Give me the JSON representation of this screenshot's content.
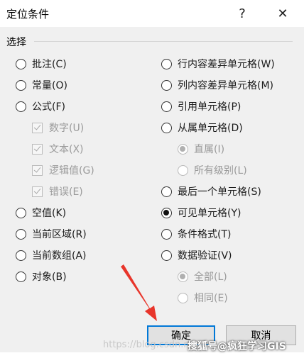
{
  "dialog": {
    "title": "定位条件",
    "help_glyph": "?",
    "close_glyph": "✕"
  },
  "group": {
    "label": "选择"
  },
  "left_options": [
    {
      "label": "批注(C)",
      "type": "radio",
      "checked": false,
      "disabled": false
    },
    {
      "label": "常量(O)",
      "type": "radio",
      "checked": false,
      "disabled": false
    },
    {
      "label": "公式(F)",
      "type": "radio",
      "checked": false,
      "disabled": false
    },
    {
      "label": "数字(U)",
      "type": "checkbox",
      "checked": true,
      "disabled": true
    },
    {
      "label": "文本(X)",
      "type": "checkbox",
      "checked": true,
      "disabled": true
    },
    {
      "label": "逻辑值(G)",
      "type": "checkbox",
      "checked": true,
      "disabled": true
    },
    {
      "label": "错误(E)",
      "type": "checkbox",
      "checked": true,
      "disabled": true
    },
    {
      "label": "空值(K)",
      "type": "radio",
      "checked": false,
      "disabled": false
    },
    {
      "label": "当前区域(R)",
      "type": "radio",
      "checked": false,
      "disabled": false
    },
    {
      "label": "当前数组(A)",
      "type": "radio",
      "checked": false,
      "disabled": false
    },
    {
      "label": "对象(B)",
      "type": "radio",
      "checked": false,
      "disabled": false
    }
  ],
  "right_options": [
    {
      "label": "行内容差异单元格(W)",
      "type": "radio",
      "checked": false,
      "disabled": false
    },
    {
      "label": "列内容差异单元格(M)",
      "type": "radio",
      "checked": false,
      "disabled": false
    },
    {
      "label": "引用单元格(P)",
      "type": "radio",
      "checked": false,
      "disabled": false
    },
    {
      "label": "从属单元格(D)",
      "type": "radio",
      "checked": false,
      "disabled": false
    },
    {
      "label": "直属(I)",
      "type": "radio",
      "checked": true,
      "disabled": true
    },
    {
      "label": "所有级别(L)",
      "type": "radio",
      "checked": false,
      "disabled": true
    },
    {
      "label": "最后一个单元格(S)",
      "type": "radio",
      "checked": false,
      "disabled": false
    },
    {
      "label": "可见单元格(Y)",
      "type": "radio",
      "checked": true,
      "disabled": false
    },
    {
      "label": "条件格式(T)",
      "type": "radio",
      "checked": false,
      "disabled": false
    },
    {
      "label": "数据验证(V)",
      "type": "radio",
      "checked": false,
      "disabled": false
    },
    {
      "label": "全部(L)",
      "type": "radio",
      "checked": true,
      "disabled": true
    },
    {
      "label": "相同(E)",
      "type": "radio",
      "checked": false,
      "disabled": true
    }
  ],
  "buttons": {
    "ok": "确定",
    "cancel": "取消"
  },
  "watermark": {
    "light": "https://blog.csdn.net",
    "dark": "搜狐号@疯狂学习GIS"
  },
  "colors": {
    "annotation_arrow": "#e8352b",
    "primary_button_border": "#0078d7"
  }
}
